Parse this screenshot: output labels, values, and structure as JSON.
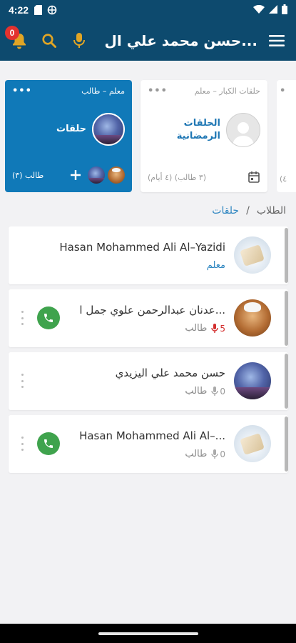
{
  "status_bar": {
    "time": "4:22"
  },
  "app_bar": {
    "title": "حسن محمد علي ال...",
    "notification_count": "0"
  },
  "cards": [
    {
      "role": "معلم – طالب",
      "name": "حلقات",
      "students_text": "طالب (٣)",
      "active": true
    },
    {
      "role": "حلقات الكبار – معلم",
      "name_line1": "الحلقات",
      "name_line2": "الرمضانية",
      "info_text": "(٤ أيام) (٣ طالب)",
      "active": false
    },
    {
      "info_text": "(٤"
    }
  ],
  "breadcrumb": {
    "root": "الطلاب",
    "separator": "/",
    "current": "حلقات"
  },
  "members": [
    {
      "name": "Hasan Mohammed Ali Al–Yazidi",
      "role": "معلم",
      "avatar": "book",
      "is_teacher": true
    },
    {
      "name": "عدنان عبدالرحمن علوي جمل ا...",
      "role": "طالب",
      "recordings": "5",
      "avatar": "man",
      "is_teacher": false
    },
    {
      "name": "حسن محمد علي اليزيدي",
      "role": "طالب",
      "recordings": "0",
      "avatar": "sky",
      "is_teacher": false
    },
    {
      "name": "Hasan Mohammed Ali Al–...",
      "role": "طالب",
      "recordings": "0",
      "avatar": "book",
      "is_teacher": false
    }
  ],
  "colors": {
    "primary": "#0d4a6e",
    "card_active": "#1079b8",
    "accent": "#e0a525",
    "call_green": "#3fa34d",
    "badge_red": "#e3322f"
  },
  "icons": [
    "bell-icon",
    "search-icon",
    "mic-icon",
    "menu-icon",
    "calendar-icon",
    "add-icon",
    "phone-icon",
    "more-vert-icon"
  ]
}
